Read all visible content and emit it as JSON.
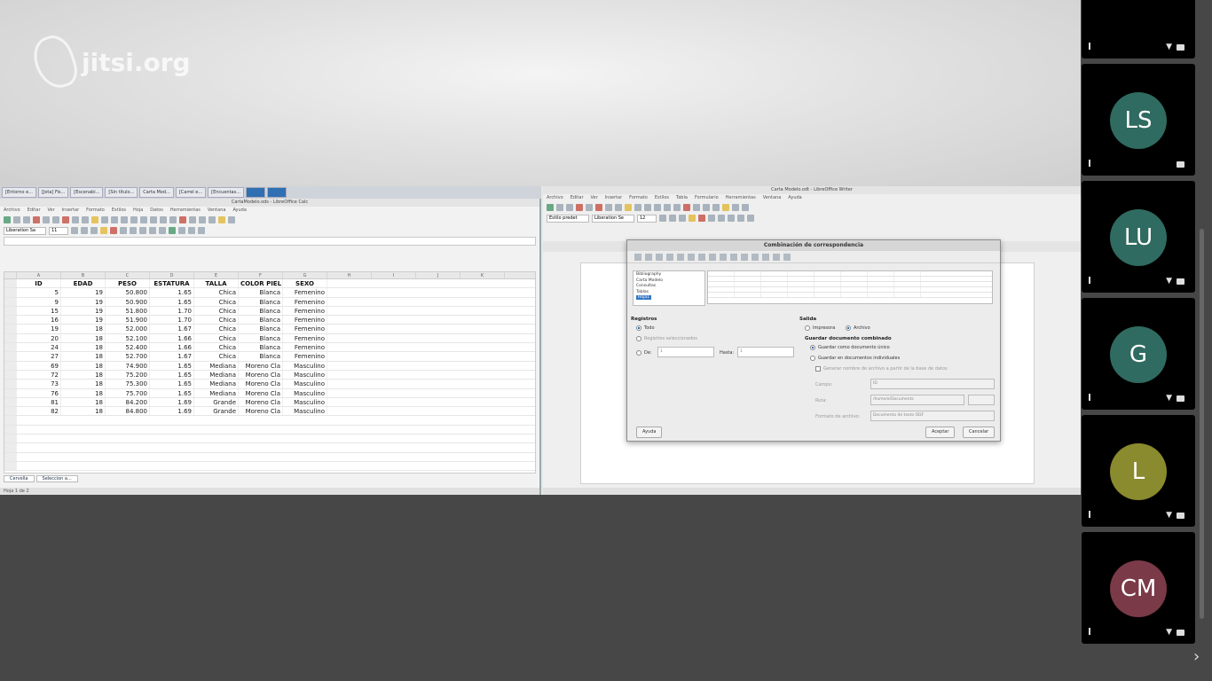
{
  "app": {
    "brand": "jitsi.org"
  },
  "taskbar": {
    "tasks": [
      "[Entorno e...",
      "[Jota] Fis...",
      "[Escenabi...",
      "[Sin título...",
      "Carta Mod...",
      "",
      "[Carrel e...",
      "[Encuentas..."
    ]
  },
  "calc": {
    "title": "CartaModelo.ods - LibreOffice Calc",
    "menu": [
      "Archivo",
      "Editar",
      "Ver",
      "Insertar",
      "Formato",
      "Estilos",
      "Hoja",
      "Datos",
      "Herramientas",
      "Ventana",
      "Ayuda"
    ],
    "font_name": "Liberation Sa",
    "font_size": "11",
    "col_headers": [
      "A",
      "B",
      "C",
      "D",
      "E",
      "F",
      "G",
      "H",
      "I",
      "J",
      "K",
      "L"
    ],
    "header_row": [
      "ID",
      "EDAD",
      "PESO",
      "ESTATURA",
      "TALLA",
      "COLOR PIEL",
      "SEXO"
    ],
    "rows": [
      [
        "5",
        "19",
        "50.800",
        "1.65",
        "Chica",
        "Blanca",
        "Femenino"
      ],
      [
        "9",
        "19",
        "50.900",
        "1.65",
        "Chica",
        "Blanca",
        "Femenino"
      ],
      [
        "15",
        "19",
        "51.800",
        "1.70",
        "Chica",
        "Blanca",
        "Femenino"
      ],
      [
        "16",
        "19",
        "51.900",
        "1.70",
        "Chica",
        "Blanca",
        "Femenino"
      ],
      [
        "19",
        "18",
        "52.000",
        "1.67",
        "Chica",
        "Blanca",
        "Femenino"
      ],
      [
        "20",
        "18",
        "52.100",
        "1.66",
        "Chica",
        "Blanca",
        "Femenino"
      ],
      [
        "24",
        "18",
        "52.400",
        "1.66",
        "Chica",
        "Blanca",
        "Femenino"
      ],
      [
        "27",
        "18",
        "52.700",
        "1.67",
        "Chica",
        "Blanca",
        "Femenino"
      ],
      [
        "69",
        "18",
        "74.900",
        "1.65",
        "Mediana",
        "Moreno Cla",
        "Masculino"
      ],
      [
        "72",
        "18",
        "75.200",
        "1.65",
        "Mediana",
        "Moreno Cla",
        "Masculino"
      ],
      [
        "73",
        "18",
        "75.300",
        "1.65",
        "Mediana",
        "Moreno Cla",
        "Masculino"
      ],
      [
        "76",
        "18",
        "75.700",
        "1.65",
        "Mediana",
        "Moreno Cla",
        "Masculino"
      ],
      [
        "81",
        "18",
        "84.200",
        "1.69",
        "Grande",
        "Moreno Cla",
        "Masculino"
      ],
      [
        "82",
        "18",
        "84.800",
        "1.69",
        "Grande",
        "Moreno Cla",
        "Masculino"
      ]
    ],
    "sheet_tabs": [
      "Cervella",
      "Seleccion a..."
    ],
    "status": "Hoja 1 de 2"
  },
  "writer": {
    "title": "Carta Modelo.odt - LibreOffice Writer",
    "menu": [
      "Archivo",
      "Editar",
      "Ver",
      "Insertar",
      "Formato",
      "Estilos",
      "Tabla",
      "Formulario",
      "Herramientas",
      "Ventana",
      "Ayuda"
    ],
    "style_name": "Estilo predet",
    "font_name": "Liberation Se",
    "font_size": "12"
  },
  "dialog": {
    "title": "Combinación de correspondencia",
    "tree": [
      "Bibliography",
      "Carta Modelo",
      "Consultas",
      "Tablas",
      "Hoja1"
    ],
    "registros_label": "Registros",
    "opt_todo": "Todo",
    "opt_seleccionados": "Registros seleccionados",
    "opt_de": "De:",
    "opt_hasta": "Hasta:",
    "de_value": "1",
    "hasta_value": "1",
    "salida_label": "Salida",
    "opt_impresora": "Impresora",
    "opt_archivo": "Archivo",
    "guardar_label": "Guardar documento combinado",
    "opt_guardar_unico": "Guardar como documento único",
    "opt_guardar_individual": "Guardar en documentos individuales",
    "opt_generar_nombre": "Generar nombre de archivo a partir de la base de datos",
    "campo_label": "Campo:",
    "campo_value": "ID",
    "ruta_label": "Ruta:",
    "ruta_value": "/home/e/Documents",
    "formato_label": "Formato de archivo:",
    "formato_value": "Documento de texto ODF",
    "ayuda_button": "Ayuda",
    "aceptar_button": "Aceptar",
    "cancelar_button": "Cancelar"
  },
  "participants": [
    {
      "initials": "",
      "color": "#2a2a2a"
    },
    {
      "initials": "LS",
      "color": "#2f6b60"
    },
    {
      "initials": "LU",
      "color": "#2f6b60"
    },
    {
      "initials": "G",
      "color": "#2f6b60"
    },
    {
      "initials": "L",
      "color": "#8a8a2e"
    },
    {
      "initials": "CM",
      "color": "#7a3a48"
    }
  ]
}
